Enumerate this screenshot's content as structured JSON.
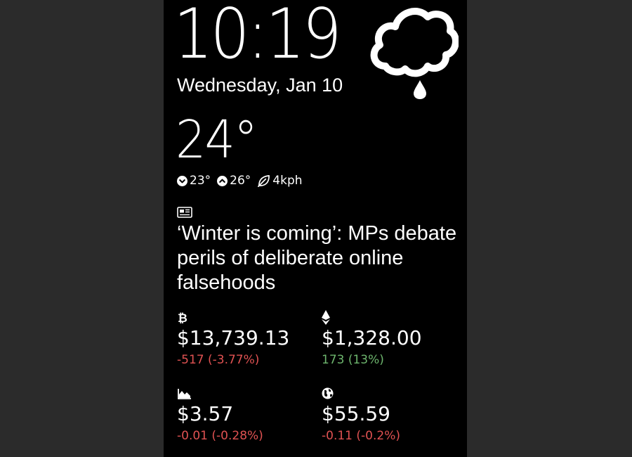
{
  "clock": {
    "time": "10:19",
    "date": "Wednesday, Jan 10"
  },
  "weather": {
    "icon": "cloud-rain-icon",
    "temperature": "24°",
    "low": "23°",
    "high": "26°",
    "wind": "4kph"
  },
  "news": {
    "icon": "newspaper-icon",
    "headline": "‘Winter is coming’: MPs debate perils of deliberate online falsehoods"
  },
  "tickers": [
    {
      "icon": "bitcoin-icon",
      "price": "$13,739.13",
      "change": "-517 (-3.77%)",
      "trend": "down"
    },
    {
      "icon": "ethereum-icon",
      "price": "$1,328.00",
      "change": "173 (13%)",
      "trend": "up"
    },
    {
      "icon": "area-chart-icon",
      "price": "$3.57",
      "change": "-0.01 (-0.28%)",
      "trend": "down"
    },
    {
      "icon": "globe-icon",
      "price": "$55.59",
      "change": "-0.11 (-0.2%)",
      "trend": "down"
    }
  ],
  "colors": {
    "negative": "#e05252",
    "positive": "#6db56d",
    "background": "#000000",
    "bezel": "#2b2b2b"
  }
}
